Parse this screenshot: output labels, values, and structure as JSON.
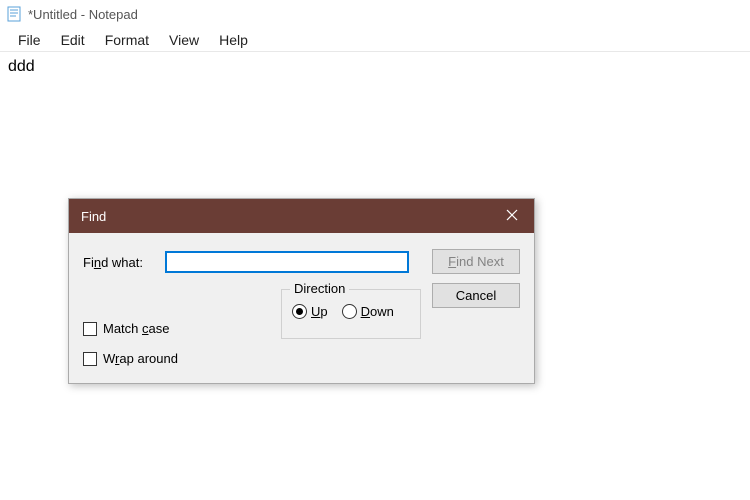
{
  "window": {
    "title": "*Untitled - Notepad"
  },
  "menu": {
    "file": "File",
    "edit": "Edit",
    "format": "Format",
    "view": "View",
    "help": "Help"
  },
  "editor": {
    "content": "ddd"
  },
  "dialog": {
    "title": "Find",
    "find_what_label": "Find what:",
    "find_what_value": "",
    "direction_label": "Direction",
    "up_label": "Up",
    "down_label": "Down",
    "direction_selected": "up",
    "match_case_label": "Match case",
    "match_case_checked": false,
    "wrap_around_label": "Wrap around",
    "wrap_around_checked": false,
    "find_next_label": "Find Next",
    "find_next_enabled": false,
    "cancel_label": "Cancel"
  }
}
